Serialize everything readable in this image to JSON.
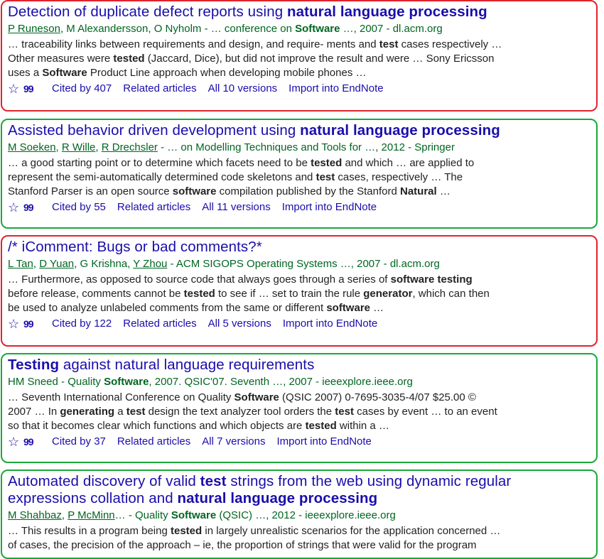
{
  "results": [
    {
      "title_a": "Detection of duplicate defect reports using ",
      "title_b": "natural language processing",
      "authors": [
        "P Runeson",
        "M Alexandersson",
        "O Nyholm"
      ],
      "author_sep": ", ",
      "venue_a": " - … conference on ",
      "venue_bold": "Software",
      "venue_b": " …, 2007 - dl.acm.org",
      "snippet": [
        [
          "… traceability links between requirements and design, and require- ments and ",
          "test",
          " cases respectively …"
        ],
        [
          "Other measures were ",
          "tested",
          " (Jaccard, Dice), but did not improve the result and were … Sony Ericsson"
        ],
        [
          "uses a ",
          "Software",
          " Product Line approach when developing mobile phones …"
        ]
      ],
      "cited": "Cited by 407",
      "related": "Related articles",
      "versions": "All 10 versions",
      "import": "Import into EndNote"
    },
    {
      "title_a": "Assisted behavior driven development using ",
      "title_b": "natural language processing",
      "authors": [
        "M Soeken",
        "R Wille",
        "R Drechsler"
      ],
      "venue_a": " - … on Modelling Techniques and Tools for …, 2012 - Springer",
      "snippet": [
        [
          "… a good starting point or to determine which facets need to be ",
          "tested",
          " and which … are applied to"
        ],
        [
          "represent the semi-automatically determined code skeletons and ",
          "test",
          " cases, respectively … The"
        ],
        [
          "Stanford Parser is an open source ",
          "software",
          " compilation published by the Stanford ",
          "Natural",
          " …"
        ]
      ],
      "cited": "Cited by 55",
      "related": "Related articles",
      "versions": "All 11 versions",
      "import": "Import into EndNote"
    },
    {
      "title_a": "/* iComment: Bugs or bad comments?*",
      "authors": [
        "L Tan",
        "D Yuan",
        "G Krishna",
        "Y Zhou"
      ],
      "venue_a": " - ACM SIGOPS Operating Systems …, 2007 - dl.acm.org",
      "snippet": [
        [
          "… Furthermore, as opposed to source code that always goes through a series of ",
          "software testing",
          ""
        ],
        [
          "before release, comments cannot be ",
          "tested",
          " to see if … set to train the rule ",
          "generator",
          ", which can then"
        ],
        [
          "be used to analyze unlabeled comments from the same or different ",
          "software",
          " …"
        ]
      ],
      "cited": "Cited by 122",
      "related": "Related articles",
      "versions": "All 5 versions",
      "import": "Import into EndNote"
    },
    {
      "title_bold": "Testing",
      "title_a": " against natural language requirements",
      "venue_plain_a": "HM Sneed - Quality ",
      "venue_bold": "Software",
      "venue_b": ", 2007. QSIC'07. Seventh …, 2007 - ieeexplore.ieee.org",
      "snippet": [
        [
          "… Seventh International Conference on Quality ",
          "Software",
          " (QSIC 2007) 0-7695-3035-4/07 $25.00 ©"
        ],
        [
          "2007 … In ",
          "generating",
          " a ",
          "test",
          " design the text analyzer tool orders the ",
          "test",
          " cases by event … to an event"
        ],
        [
          "so that it becomes clear which functions and which objects are ",
          "tested",
          " within a …"
        ]
      ],
      "cited": "Cited by 37",
      "related": "Related articles",
      "versions": "All 7 versions",
      "import": "Import into EndNote"
    },
    {
      "title_a": "Automated discovery of valid ",
      "title_bold1": "test",
      "title_b": " strings from the web using dynamic regular",
      "title_c": "expressions collation and ",
      "title_bold2": "natural language processing",
      "authors": [
        "M Shahbaz",
        "P McMinn"
      ],
      "venue_a": "… - Quality ",
      "venue_bold": "Software",
      "venue_b": " (QSIC) …, 2012 - ieeexplore.ieee.org",
      "snippet": [
        [
          "… This results in a program being ",
          "tested",
          " in largely unrealistic scenarios for the application concerned …"
        ],
        [
          "of cases, the precision of the approach – ie, the proportion of strings that were valid for the program",
          "",
          ""
        ]
      ]
    }
  ],
  "icons": {
    "star": "☆",
    "quote": "99"
  },
  "colors": {
    "link": "#1a0dab",
    "author": "#006621",
    "text": "#222222",
    "red_border": "#e0242e",
    "green_border": "#1aa83a"
  }
}
